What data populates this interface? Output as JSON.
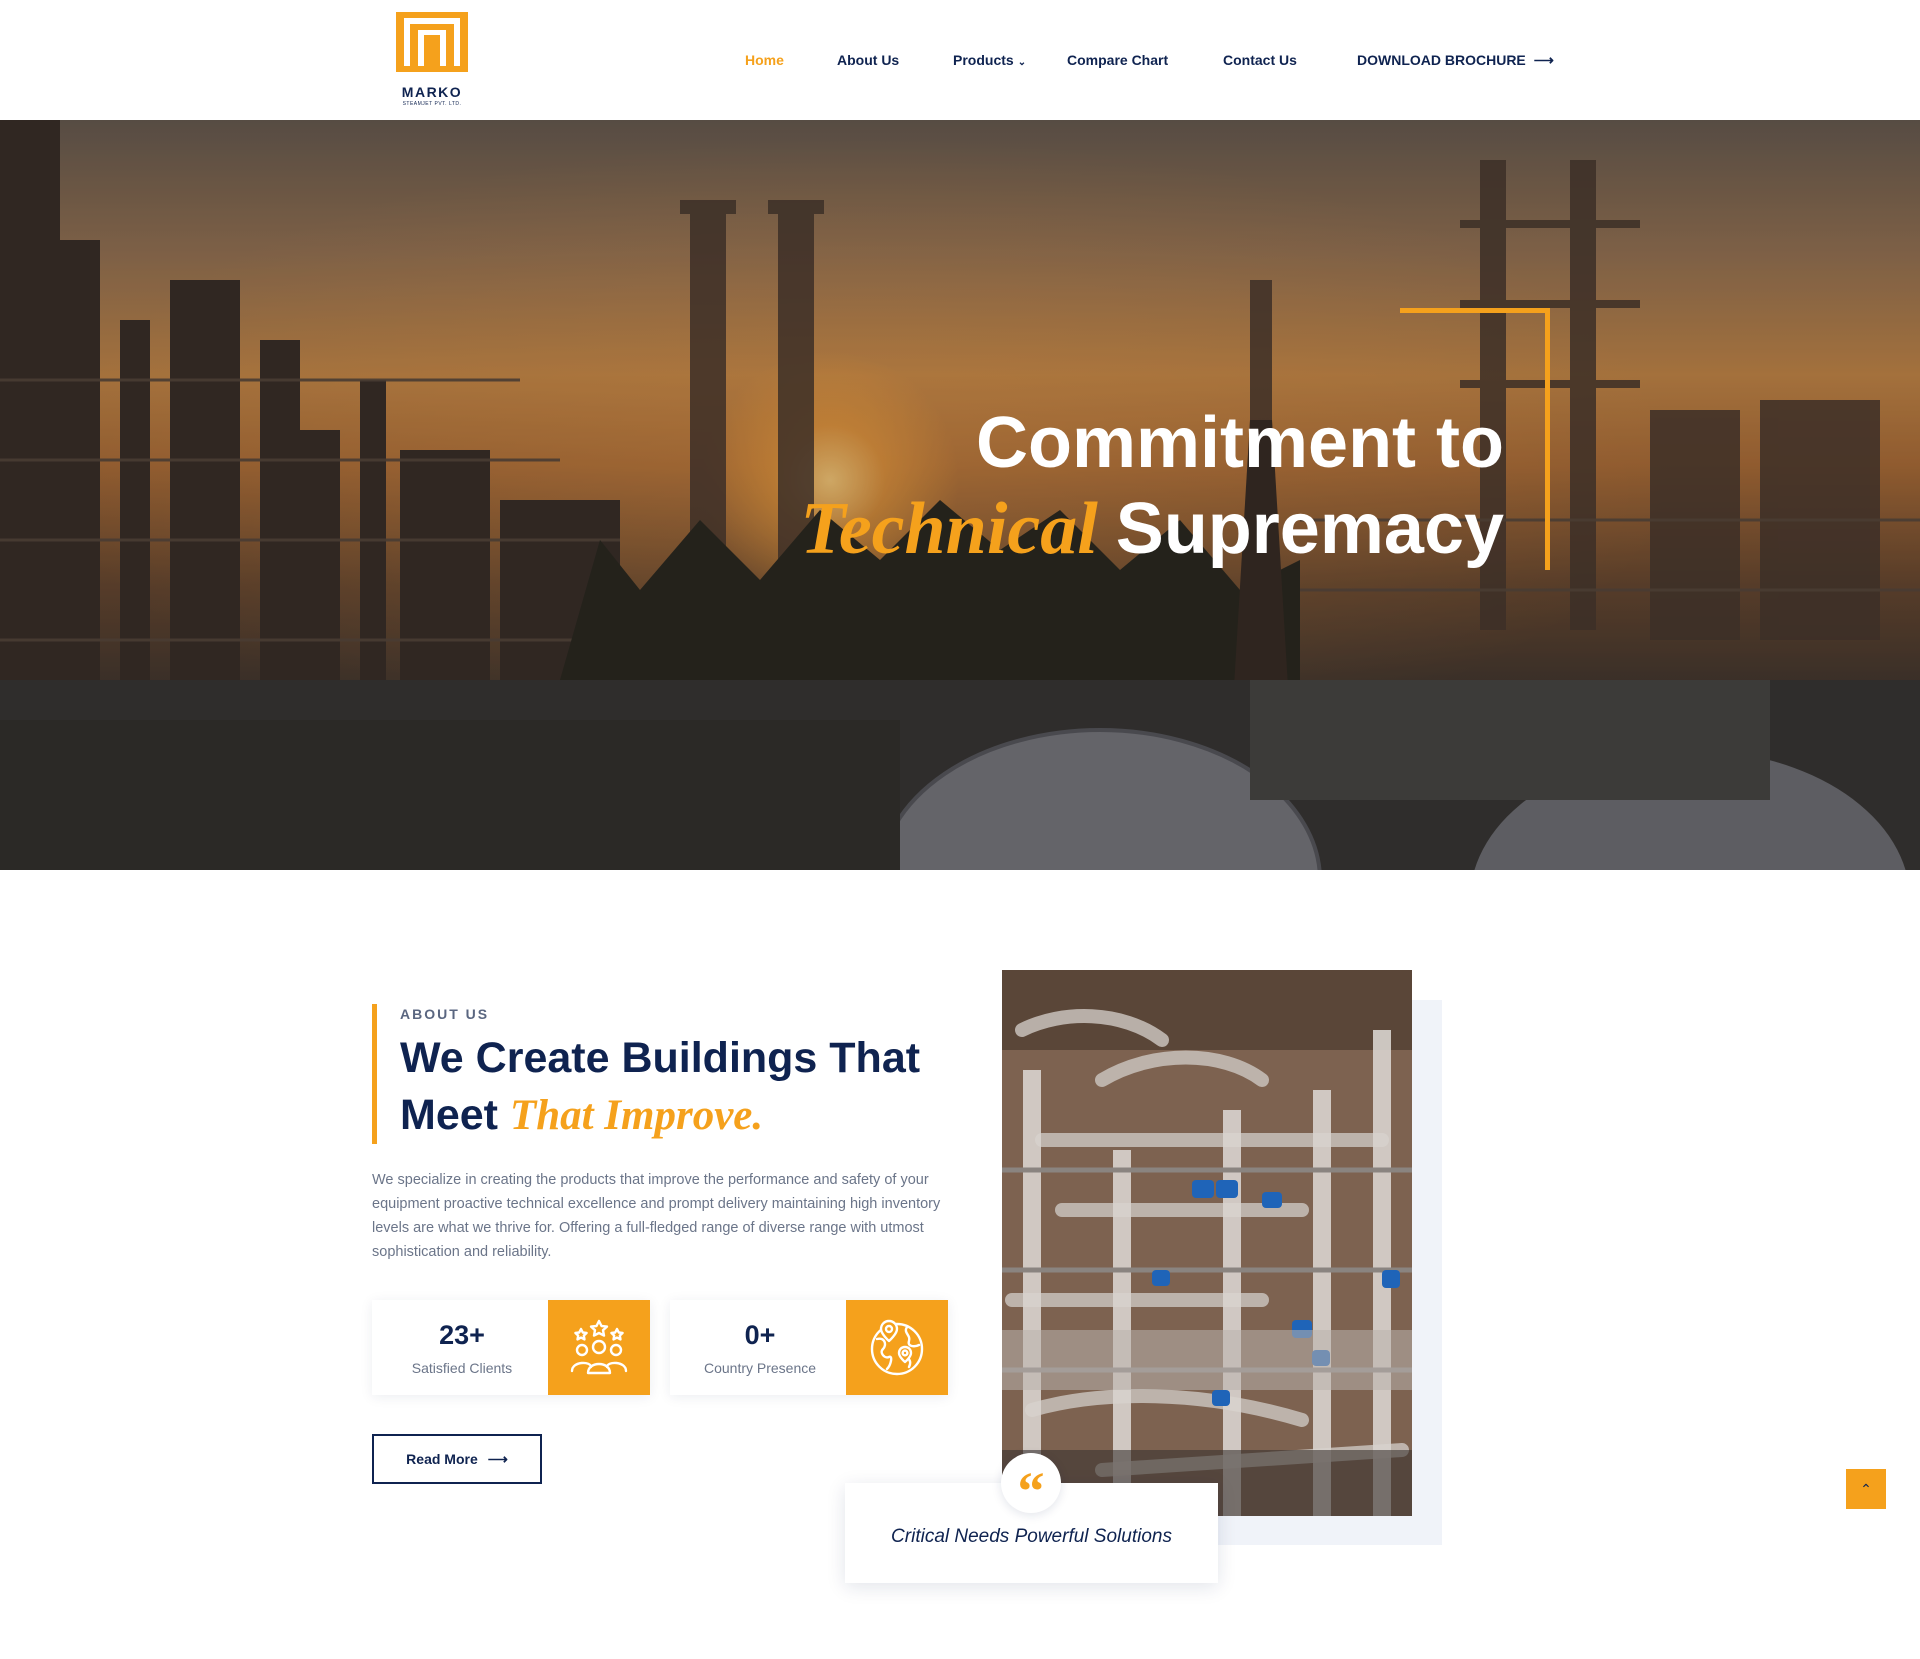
{
  "brand": {
    "name": "MARKO",
    "tagline": "STEAMJET PVT. LTD.",
    "accent": "#f5a11c",
    "navy": "#0f2350"
  },
  "nav": {
    "items": [
      {
        "label": "Home",
        "active": true
      },
      {
        "label": "About Us"
      },
      {
        "label": "Products",
        "icon": "chevron-down-icon"
      },
      {
        "label": "Compare Chart"
      },
      {
        "label": "Contact Us"
      }
    ],
    "cta": {
      "label": "DOWNLOAD BROCHURE",
      "icon": "arrow-right-icon"
    }
  },
  "hero": {
    "line1": "Commitment to",
    "highlight": "Technical",
    "line2_rest": "Supremacy"
  },
  "about": {
    "eyebrow": "ABOUT US",
    "title_line1": "We Create Buildings That",
    "title_line2": "Meet",
    "title_highlight": "That Improve.",
    "text": "We specialize in creating the products that improve the performance and safety of your equipment proactive technical excellence and prompt delivery maintaining high inventory levels are what we thrive for. Offering a full-fledged range of diverse range with utmost sophistication and reliability.",
    "stats": [
      {
        "value": "23+",
        "label": "Satisfied Clients",
        "icon": "clients-icon"
      },
      {
        "value": "0+",
        "label": "Country Presence",
        "icon": "globe-location-icon"
      }
    ],
    "read_more": "Read More",
    "quote": "Critical Needs Powerful Solutions",
    "quote_mark": "“"
  },
  "scroll_top_icon": "chevron-up-icon"
}
